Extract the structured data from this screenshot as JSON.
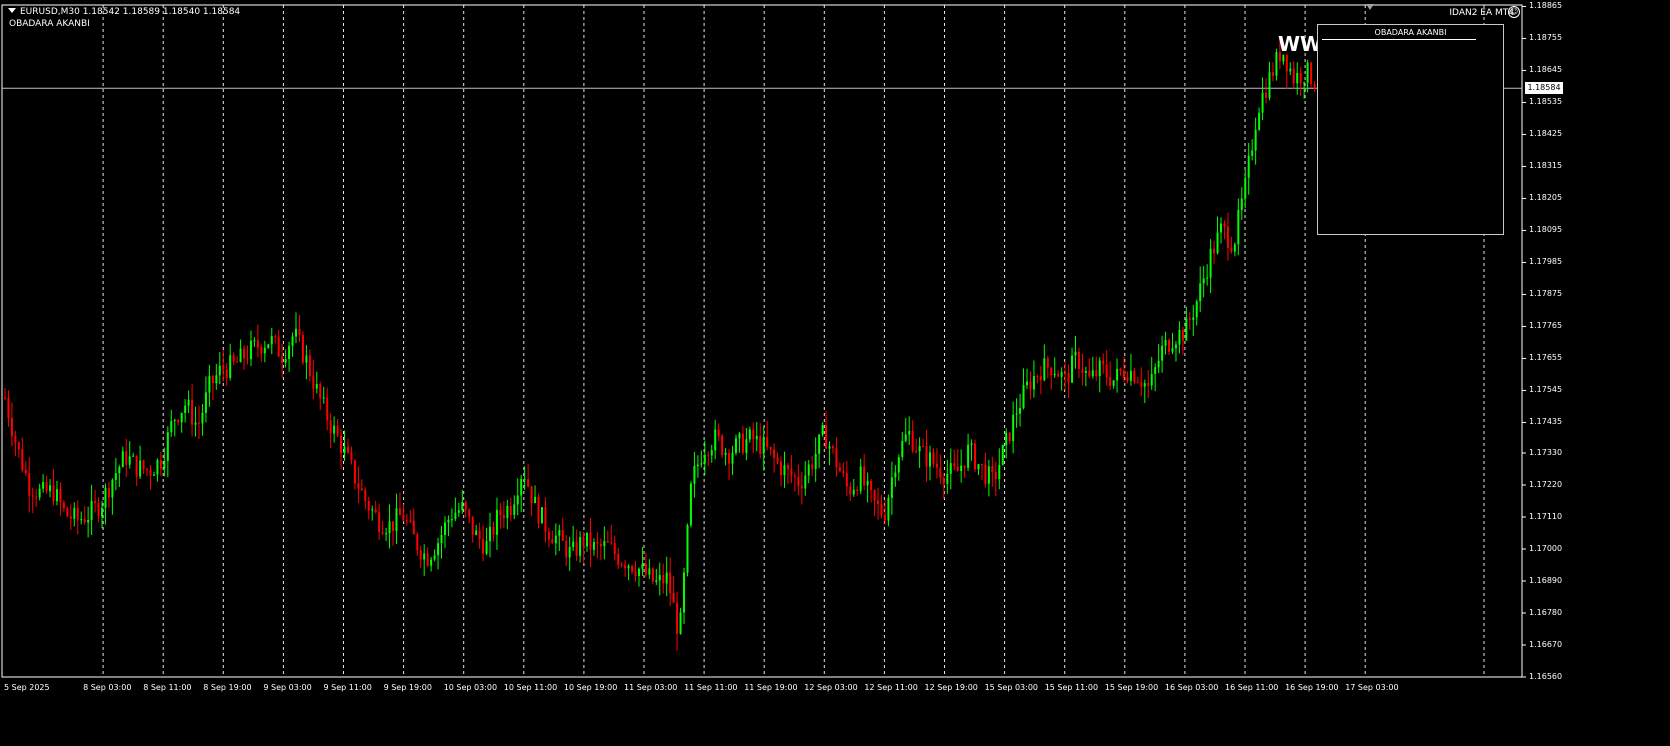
{
  "header": {
    "symbol_line": "EURUSD,M30  1.18542 1.18589 1.18540 1.18584",
    "indicator": "OBADARA AKANBI",
    "ea_name": "IDAN2 EA MT4",
    "smile_icon": "☺"
  },
  "panel": {
    "title": "OBADARA AKANBI",
    "overlay_text": "WW"
  },
  "current_price": "1.18584",
  "colors": {
    "background": "#000000",
    "bull": "#00ff00",
    "bear": "#ff0000",
    "grid": "#ffffff",
    "price_line": "#c0c0c0"
  },
  "chart_data": {
    "type": "candlestick",
    "symbol": "EURUSD",
    "timeframe": "M30",
    "ylim": [
      1.1656,
      1.1887
    ],
    "y_ticks": [
      "1.18865",
      "1.18755",
      "1.18645",
      "1.18535",
      "1.18425",
      "1.18315",
      "1.18205",
      "1.18095",
      "1.17985",
      "1.17875",
      "1.17765",
      "1.17655",
      "1.17545",
      "1.17435",
      "1.17330",
      "1.17220",
      "1.17110",
      "1.17000",
      "1.16890",
      "1.16780",
      "1.16670",
      "1.16560"
    ],
    "x_ticks": [
      "5 Sep 2025",
      "8 Sep 03:00",
      "8 Sep 11:00",
      "8 Sep 19:00",
      "9 Sep 03:00",
      "9 Sep 11:00",
      "9 Sep 19:00",
      "10 Sep 03:00",
      "10 Sep 11:00",
      "10 Sep 19:00",
      "11 Sep 03:00",
      "11 Sep 11:00",
      "11 Sep 19:00",
      "12 Sep 03:00",
      "12 Sep 11:00",
      "12 Sep 19:00",
      "15 Sep 03:00",
      "15 Sep 11:00",
      "15 Sep 19:00",
      "16 Sep 03:00",
      "16 Sep 11:00",
      "16 Sep 19:00",
      "17 Sep 03:00"
    ],
    "close_path": [
      1.1752,
      1.1735,
      1.1722,
      1.1719,
      1.172,
      1.1712,
      1.171,
      1.1712,
      1.1716,
      1.1725,
      1.1732,
      1.1728,
      1.1727,
      1.1731,
      1.1745,
      1.175,
      1.1742,
      1.1756,
      1.1762,
      1.1763,
      1.1767,
      1.177,
      1.1772,
      1.1767,
      1.1774,
      1.1765,
      1.1753,
      1.1743,
      1.1735,
      1.1725,
      1.1716,
      1.171,
      1.1708,
      1.1712,
      1.1703,
      1.1697,
      1.1703,
      1.1712,
      1.1714,
      1.1705,
      1.1701,
      1.1712,
      1.1715,
      1.1728,
      1.1715,
      1.1707,
      1.1703,
      1.1698,
      1.1703,
      1.17,
      1.1701,
      1.1697,
      1.1695,
      1.1692,
      1.1688,
      1.169,
      1.167,
      1.1723,
      1.1735,
      1.1738,
      1.1733,
      1.1736,
      1.1738,
      1.1735,
      1.173,
      1.1726,
      1.1723,
      1.173,
      1.174,
      1.173,
      1.172,
      1.1725,
      1.1716,
      1.1712,
      1.1732,
      1.174,
      1.1733,
      1.173,
      1.1726,
      1.1726,
      1.1734,
      1.1728,
      1.1723,
      1.1735,
      1.1748,
      1.1757,
      1.1762,
      1.1763,
      1.1758,
      1.1766,
      1.1758,
      1.1762,
      1.1758,
      1.1762,
      1.176,
      1.1755,
      1.1768,
      1.1773,
      1.1775,
      1.1786,
      1.18,
      1.181,
      1.1805,
      1.1825,
      1.1852,
      1.1862,
      1.1872,
      1.1862,
      1.1864,
      1.186
    ]
  }
}
